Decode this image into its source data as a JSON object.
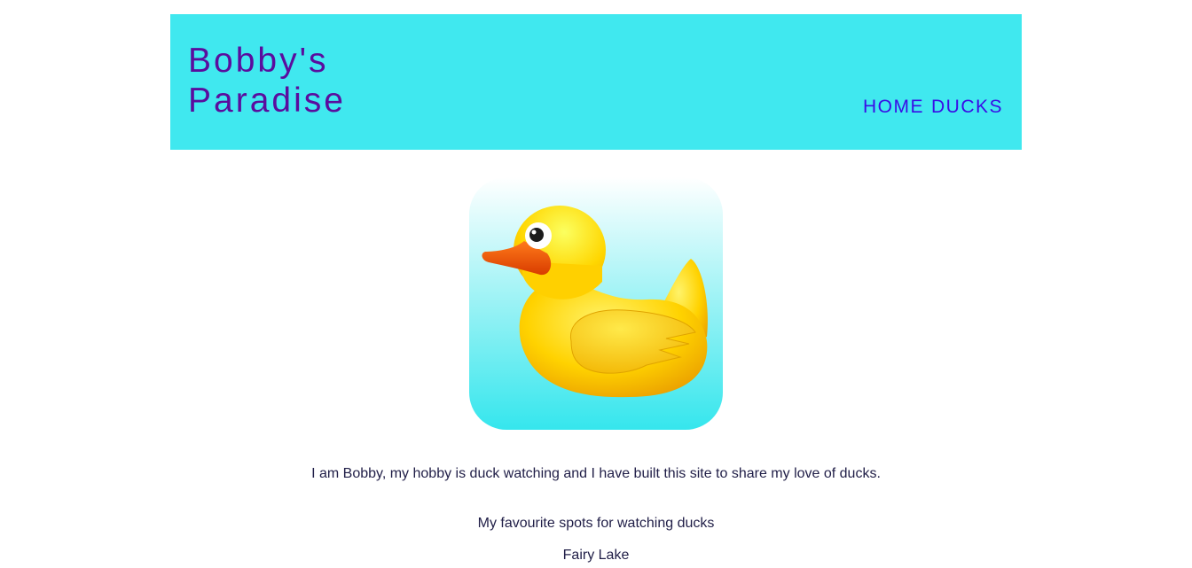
{
  "header": {
    "title": "Bobby's\nParadise",
    "nav": [
      {
        "label": "HOME"
      },
      {
        "label": "DUCKS"
      }
    ]
  },
  "hero": {
    "icon": "rubber-duck-icon",
    "colors": {
      "bg_top": "#ffffff",
      "bg_bottom": "#3be7ee",
      "duck": "#ffd400",
      "beak": "#f05a10"
    }
  },
  "main": {
    "intro": "I am Bobby, my hobby is duck watching and I have built this site to share my love of ducks.",
    "spots_heading": "My favourite spots for watching ducks",
    "spots": [
      "Fairy Lake"
    ]
  },
  "colors": {
    "header_bg": "#40e8ef",
    "title": "#5a0d9e",
    "nav_link": "#3a0ce6",
    "body_text": "#201e47"
  }
}
